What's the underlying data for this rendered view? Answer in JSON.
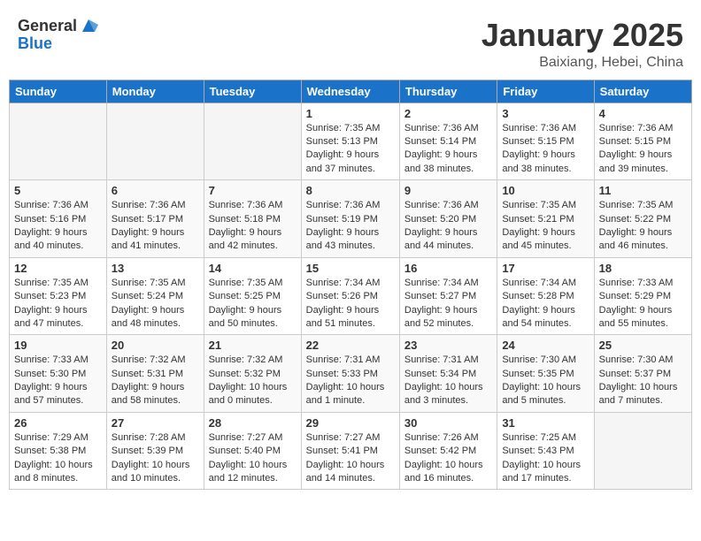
{
  "header": {
    "logo_general": "General",
    "logo_blue": "Blue",
    "month": "January 2025",
    "location": "Baixiang, Hebei, China"
  },
  "weekdays": [
    "Sunday",
    "Monday",
    "Tuesday",
    "Wednesday",
    "Thursday",
    "Friday",
    "Saturday"
  ],
  "weeks": [
    [
      {
        "day": "",
        "info": ""
      },
      {
        "day": "",
        "info": ""
      },
      {
        "day": "",
        "info": ""
      },
      {
        "day": "1",
        "info": "Sunrise: 7:35 AM\nSunset: 5:13 PM\nDaylight: 9 hours and 37 minutes."
      },
      {
        "day": "2",
        "info": "Sunrise: 7:36 AM\nSunset: 5:14 PM\nDaylight: 9 hours and 38 minutes."
      },
      {
        "day": "3",
        "info": "Sunrise: 7:36 AM\nSunset: 5:15 PM\nDaylight: 9 hours and 38 minutes."
      },
      {
        "day": "4",
        "info": "Sunrise: 7:36 AM\nSunset: 5:15 PM\nDaylight: 9 hours and 39 minutes."
      }
    ],
    [
      {
        "day": "5",
        "info": "Sunrise: 7:36 AM\nSunset: 5:16 PM\nDaylight: 9 hours and 40 minutes."
      },
      {
        "day": "6",
        "info": "Sunrise: 7:36 AM\nSunset: 5:17 PM\nDaylight: 9 hours and 41 minutes."
      },
      {
        "day": "7",
        "info": "Sunrise: 7:36 AM\nSunset: 5:18 PM\nDaylight: 9 hours and 42 minutes."
      },
      {
        "day": "8",
        "info": "Sunrise: 7:36 AM\nSunset: 5:19 PM\nDaylight: 9 hours and 43 minutes."
      },
      {
        "day": "9",
        "info": "Sunrise: 7:36 AM\nSunset: 5:20 PM\nDaylight: 9 hours and 44 minutes."
      },
      {
        "day": "10",
        "info": "Sunrise: 7:35 AM\nSunset: 5:21 PM\nDaylight: 9 hours and 45 minutes."
      },
      {
        "day": "11",
        "info": "Sunrise: 7:35 AM\nSunset: 5:22 PM\nDaylight: 9 hours and 46 minutes."
      }
    ],
    [
      {
        "day": "12",
        "info": "Sunrise: 7:35 AM\nSunset: 5:23 PM\nDaylight: 9 hours and 47 minutes."
      },
      {
        "day": "13",
        "info": "Sunrise: 7:35 AM\nSunset: 5:24 PM\nDaylight: 9 hours and 48 minutes."
      },
      {
        "day": "14",
        "info": "Sunrise: 7:35 AM\nSunset: 5:25 PM\nDaylight: 9 hours and 50 minutes."
      },
      {
        "day": "15",
        "info": "Sunrise: 7:34 AM\nSunset: 5:26 PM\nDaylight: 9 hours and 51 minutes."
      },
      {
        "day": "16",
        "info": "Sunrise: 7:34 AM\nSunset: 5:27 PM\nDaylight: 9 hours and 52 minutes."
      },
      {
        "day": "17",
        "info": "Sunrise: 7:34 AM\nSunset: 5:28 PM\nDaylight: 9 hours and 54 minutes."
      },
      {
        "day": "18",
        "info": "Sunrise: 7:33 AM\nSunset: 5:29 PM\nDaylight: 9 hours and 55 minutes."
      }
    ],
    [
      {
        "day": "19",
        "info": "Sunrise: 7:33 AM\nSunset: 5:30 PM\nDaylight: 9 hours and 57 minutes."
      },
      {
        "day": "20",
        "info": "Sunrise: 7:32 AM\nSunset: 5:31 PM\nDaylight: 9 hours and 58 minutes."
      },
      {
        "day": "21",
        "info": "Sunrise: 7:32 AM\nSunset: 5:32 PM\nDaylight: 10 hours and 0 minutes."
      },
      {
        "day": "22",
        "info": "Sunrise: 7:31 AM\nSunset: 5:33 PM\nDaylight: 10 hours and 1 minute."
      },
      {
        "day": "23",
        "info": "Sunrise: 7:31 AM\nSunset: 5:34 PM\nDaylight: 10 hours and 3 minutes."
      },
      {
        "day": "24",
        "info": "Sunrise: 7:30 AM\nSunset: 5:35 PM\nDaylight: 10 hours and 5 minutes."
      },
      {
        "day": "25",
        "info": "Sunrise: 7:30 AM\nSunset: 5:37 PM\nDaylight: 10 hours and 7 minutes."
      }
    ],
    [
      {
        "day": "26",
        "info": "Sunrise: 7:29 AM\nSunset: 5:38 PM\nDaylight: 10 hours and 8 minutes."
      },
      {
        "day": "27",
        "info": "Sunrise: 7:28 AM\nSunset: 5:39 PM\nDaylight: 10 hours and 10 minutes."
      },
      {
        "day": "28",
        "info": "Sunrise: 7:27 AM\nSunset: 5:40 PM\nDaylight: 10 hours and 12 minutes."
      },
      {
        "day": "29",
        "info": "Sunrise: 7:27 AM\nSunset: 5:41 PM\nDaylight: 10 hours and 14 minutes."
      },
      {
        "day": "30",
        "info": "Sunrise: 7:26 AM\nSunset: 5:42 PM\nDaylight: 10 hours and 16 minutes."
      },
      {
        "day": "31",
        "info": "Sunrise: 7:25 AM\nSunset: 5:43 PM\nDaylight: 10 hours and 17 minutes."
      },
      {
        "day": "",
        "info": ""
      }
    ]
  ]
}
